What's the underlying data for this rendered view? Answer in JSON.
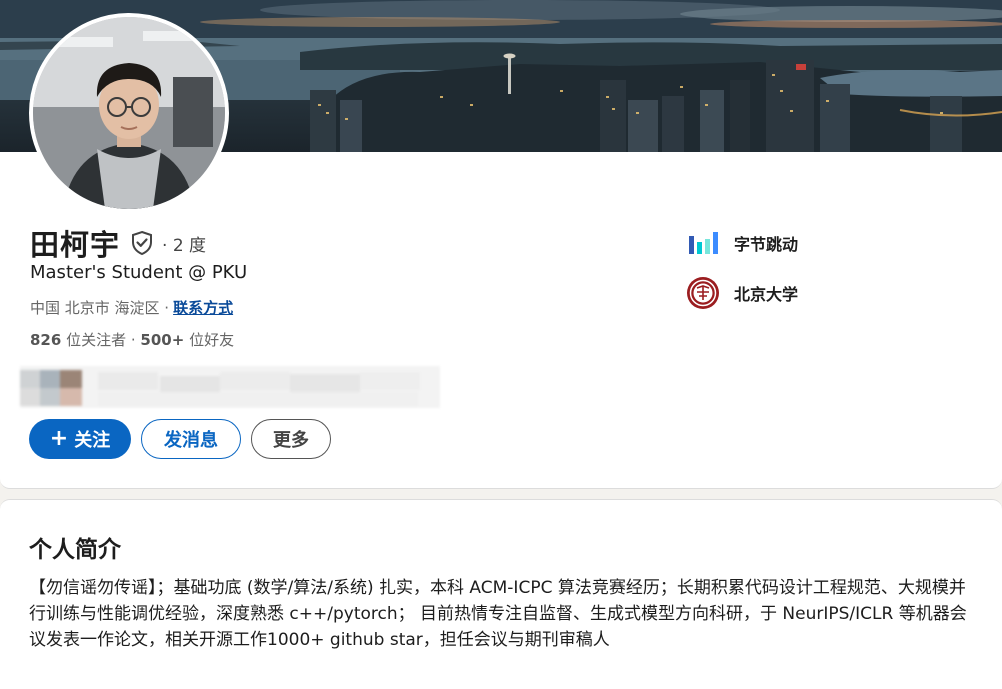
{
  "profile": {
    "name": "田柯宇",
    "degree": "· 2 度",
    "headline": "Master's Student @ PKU",
    "location": "中国 北京市 海淀区 ·",
    "contact_link": "联系方式",
    "followers_count": "826",
    "followers_label": " 位关注者",
    "friends_separator": " · ",
    "friends_count": "500+",
    "friends_label": " 位好友"
  },
  "actions": {
    "follow_label": "关注",
    "message_label": "发消息",
    "more_label": "更多"
  },
  "organizations": [
    {
      "name": "字节跳动",
      "icon": "bytedance-logo-icon"
    },
    {
      "name": "北京大学",
      "icon": "pku-logo-icon"
    }
  ],
  "about": {
    "title": "个人简介",
    "text": "【勿信谣勿传谣】；基础功底 (数学/算法/系统) 扎实，本科 ACM-ICPC 算法竞赛经历；长期积累代码设计工程规范、大规模并行训练与性能调优经验，深度熟悉 c++/pytorch； 目前热情专注自监督、生成式模型方向科研，于 NeurIPS/ICLR 等机器会议发表一作论文，相关开源工作1000+ github star，担任会议与期刊审稿人"
  },
  "colors": {
    "primary_blue": "#0a66c2",
    "link_blue": "#0a4a99",
    "page_bg": "#f4f2ee",
    "pku_red": "#9b1d20"
  }
}
